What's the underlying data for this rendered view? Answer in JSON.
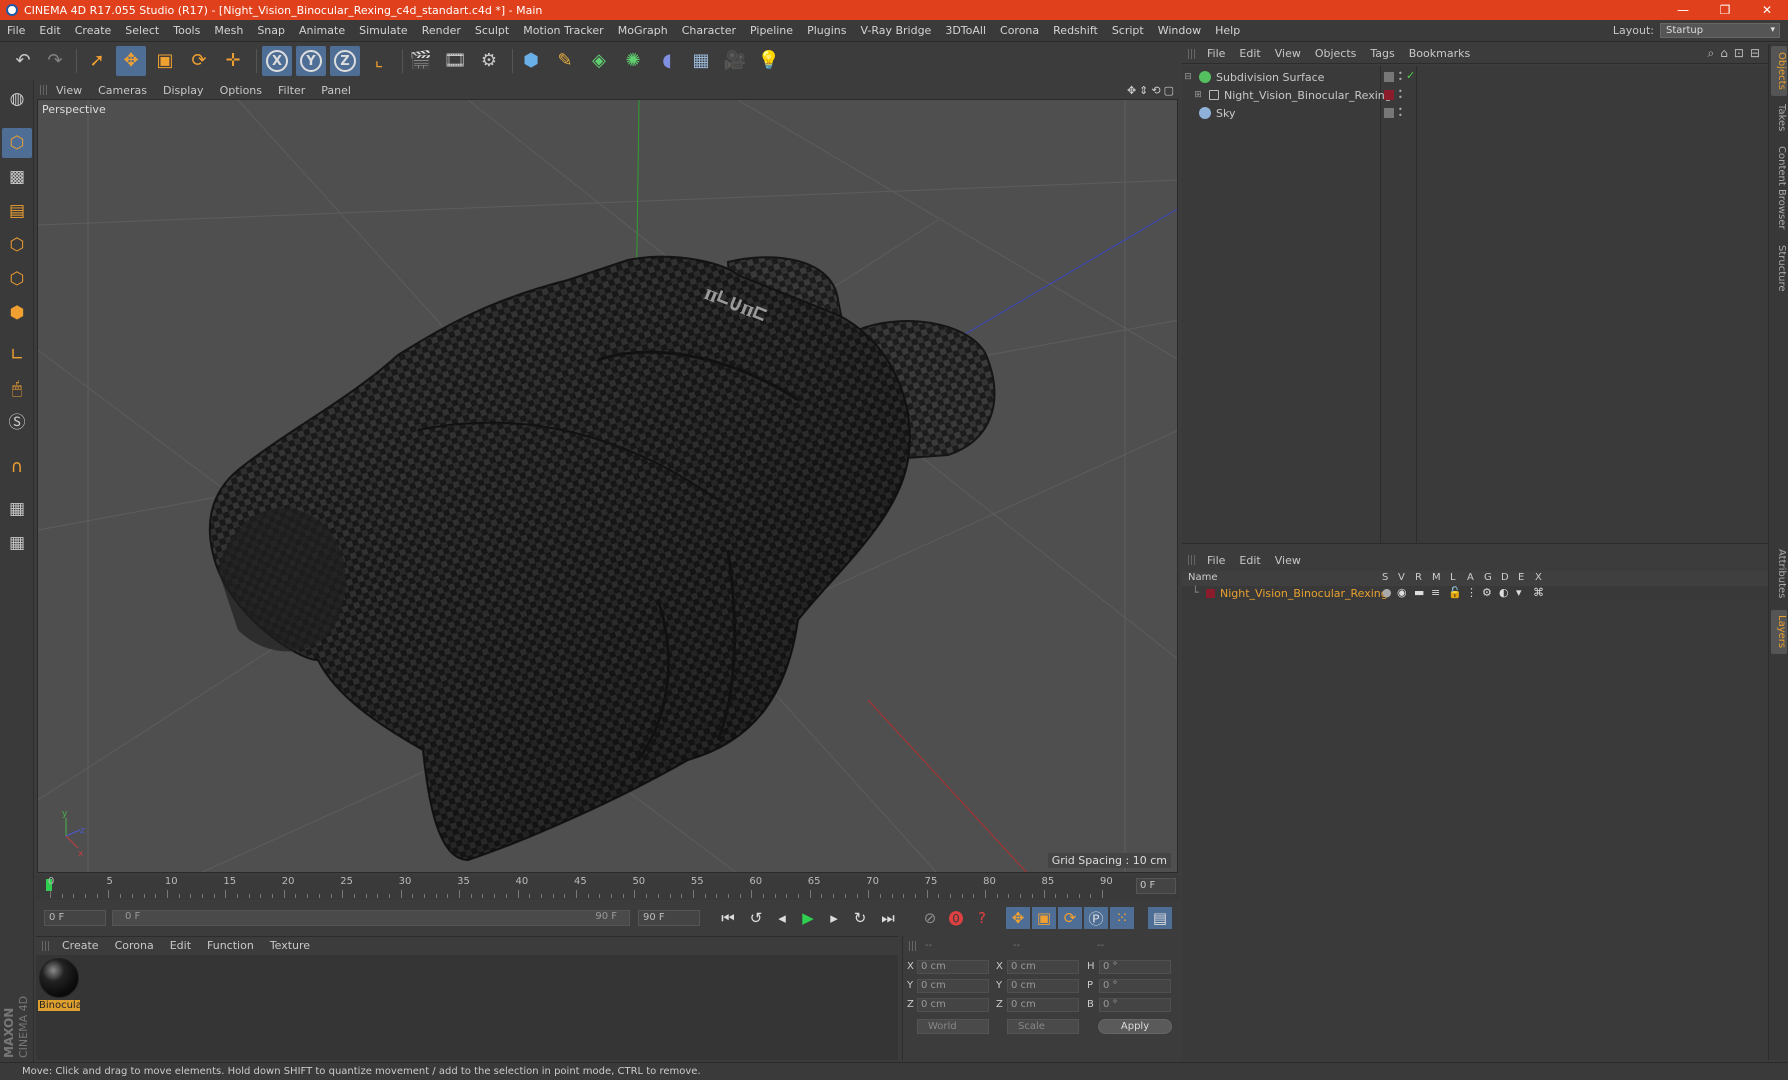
{
  "window": {
    "title": "CINEMA 4D R17.055 Studio (R17) - [Night_Vision_Binocular_Rexing_c4d_standart.c4d *] - Main",
    "controls": [
      "—",
      "❐",
      "✕"
    ]
  },
  "menubar": {
    "items": [
      "File",
      "Edit",
      "Create",
      "Select",
      "Tools",
      "Mesh",
      "Snap",
      "Animate",
      "Simulate",
      "Render",
      "Sculpt",
      "Motion Tracker",
      "MoGraph",
      "Character",
      "Pipeline",
      "Plugins",
      "V-Ray Bridge",
      "3DToAll",
      "Corona",
      "Redshift",
      "Script",
      "Window",
      "Help"
    ],
    "layout_label": "Layout:",
    "layout_value": "Startup"
  },
  "viewport": {
    "menu": [
      "View",
      "Cameras",
      "Display",
      "Options",
      "Filter",
      "Panel"
    ],
    "label": "Perspective",
    "grid_spacing": "Grid Spacing : 10 cm",
    "model_text": "ᴨ∟∪ᴨ⊏"
  },
  "timeline": {
    "ticks": [
      "0",
      "5",
      "10",
      "15",
      "20",
      "25",
      "30",
      "35",
      "40",
      "45",
      "50",
      "55",
      "60",
      "65",
      "70",
      "75",
      "80",
      "85",
      "90"
    ],
    "current_frame": "0 F"
  },
  "transport": {
    "start_field": "0 F",
    "range_start": "0 F",
    "range_end": "90 F",
    "end_field": "90 F"
  },
  "material_manager": {
    "menu": [
      "Create",
      "Corona",
      "Edit",
      "Function",
      "Texture"
    ],
    "material_name": "Binocula"
  },
  "coordinates": {
    "headers": [
      "--",
      "--",
      "--"
    ],
    "rows": [
      {
        "a": "X",
        "v1": "0 cm",
        "b": "X",
        "v2": "0 cm",
        "c": "H",
        "v3": "0 °"
      },
      {
        "a": "Y",
        "v1": "0 cm",
        "b": "Y",
        "v2": "0 cm",
        "c": "P",
        "v3": "0 °"
      },
      {
        "a": "Z",
        "v1": "0 cm",
        "b": "Z",
        "v2": "0 cm",
        "c": "B",
        "v3": "0 °"
      }
    ],
    "space": "World",
    "mode": "Scale",
    "apply": "Apply"
  },
  "object_manager": {
    "menu": [
      "File",
      "Edit",
      "View",
      "Objects",
      "Tags",
      "Bookmarks"
    ],
    "objects": [
      {
        "name": "Subdivision Surface",
        "color": "#55c060"
      },
      {
        "name": "Night_Vision_Binocular_Rexing",
        "color": "#bbbbbb"
      },
      {
        "name": "Sky",
        "color": "#8fb0d8"
      }
    ]
  },
  "layer_manager": {
    "menu": [
      "File",
      "Edit",
      "View"
    ],
    "columns": [
      "Name",
      "S",
      "V",
      "R",
      "M",
      "L",
      "A",
      "G",
      "D",
      "E",
      "X"
    ],
    "layer_name": "Night_Vision_Binocular_Rexing",
    "layer_color": "#e8a030"
  },
  "side_tabs": [
    "Objects",
    "Takes",
    "Content Browser",
    "Structure",
    "Attributes",
    "Layers"
  ],
  "status": "Move: Click and drag to move elements. Hold down SHIFT to quantize movement / add to the selection in point mode, CTRL to remove.",
  "logo": {
    "line1": "MAXON",
    "line2": "CINEMA 4D"
  },
  "colors": {
    "accent": "#e0401b",
    "selection": "#4f6e96",
    "highlight": "#e8a030"
  }
}
